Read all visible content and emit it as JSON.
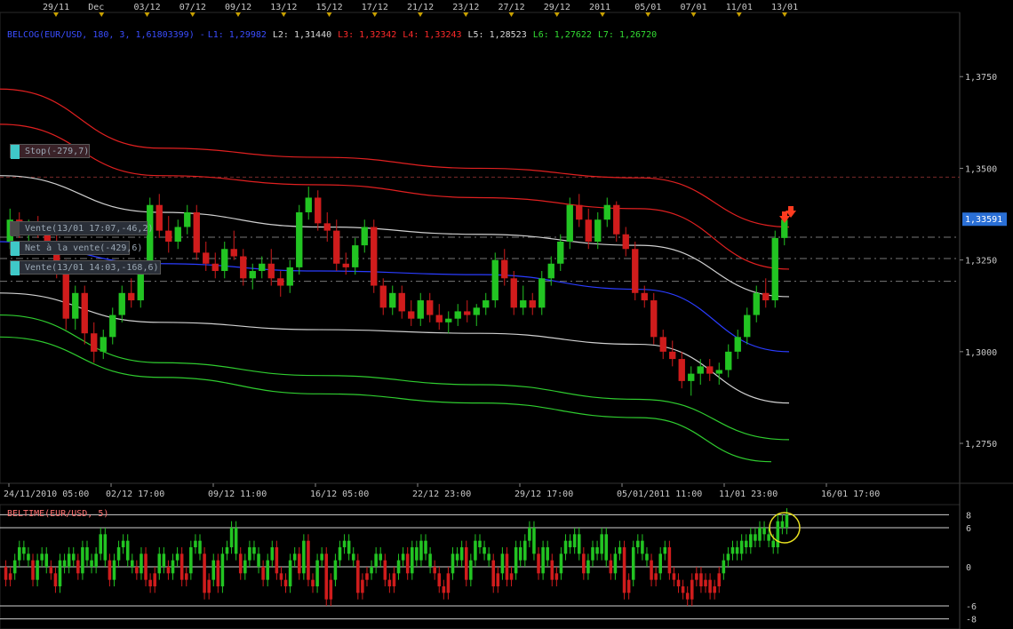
{
  "chart_data": [
    {
      "type": "candlestick",
      "legend": {
        "indicator": "BELCOG(EUR/USD, 180, 3, 1,61803399)",
        "levels": [
          {
            "label": "L1",
            "value": "1,29982",
            "color": "#3a4dff"
          },
          {
            "label": "L2",
            "value": "1,31440",
            "color": "#d8d8d8"
          },
          {
            "label": "L3",
            "value": "1,32342",
            "color": "#ff2a2a"
          },
          {
            "label": "L4",
            "value": "1,33243",
            "color": "#ff2a2a"
          },
          {
            "label": "L5",
            "value": "1,28523",
            "color": "#d8d8d8"
          },
          {
            "label": "L6",
            "value": "1,27622",
            "color": "#33dd33"
          },
          {
            "label": "L7",
            "value": "1,26720",
            "color": "#33dd33"
          }
        ]
      },
      "top_dates": [
        "29/11",
        "Dec",
        "03/12",
        "07/12",
        "09/12",
        "13/12",
        "15/12",
        "17/12",
        "21/12",
        "23/12",
        "27/12",
        "29/12",
        "2011",
        "05/01",
        "07/01",
        "11/01",
        "13/01"
      ],
      "x_labels": [
        "24/11/2010 05:00",
        "02/12 17:00",
        "09/12 11:00",
        "16/12 05:00",
        "22/12 23:00",
        "29/12 17:00",
        "05/01/2011 11:00",
        "11/01 23:00",
        "16/01 17:00"
      ],
      "y_ticks": [
        "1,3750",
        "1,3500",
        "1,3250",
        "1,3000",
        "1,2750"
      ],
      "ylim": [
        1.2675,
        1.3925
      ],
      "last_price": "1,33591",
      "horizontal_levels": [
        1.3476,
        1.3312,
        1.3254,
        1.3192
      ],
      "orders": [
        {
          "label": "Stop(-279,7)",
          "price": 1.3546,
          "color": "#3fc8c8",
          "box": "#3a2228"
        },
        {
          "label": "Vente(13/01 17:07,-46,2)",
          "price": 1.3337,
          "color": "#4a4a4a",
          "box": "#2a2f38"
        },
        {
          "label": "Net à la vente(-429,6)",
          "price": 1.3282,
          "color": "#3fc8c8",
          "box": "#2a2f38"
        },
        {
          "label": "Vente(13/01 14:03,-168,6)",
          "price": 1.323,
          "color": "#3fc8c8",
          "box": "#2a2f38"
        }
      ],
      "candles_ohlc": [
        [
          1.33,
          1.339,
          1.328,
          1.336
        ],
        [
          1.336,
          1.338,
          1.331,
          1.333
        ],
        [
          1.333,
          1.336,
          1.33,
          1.334
        ],
        [
          1.334,
          1.337,
          1.331,
          1.332
        ],
        [
          1.332,
          1.335,
          1.328,
          1.33
        ],
        [
          1.33,
          1.333,
          1.32,
          1.322
        ],
        [
          1.322,
          1.325,
          1.306,
          1.309
        ],
        [
          1.309,
          1.318,
          1.306,
          1.316
        ],
        [
          1.316,
          1.318,
          1.302,
          1.305
        ],
        [
          1.305,
          1.308,
          1.297,
          1.3
        ],
        [
          1.3,
          1.306,
          1.298,
          1.304
        ],
        [
          1.304,
          1.312,
          1.302,
          1.31
        ],
        [
          1.31,
          1.318,
          1.308,
          1.316
        ],
        [
          1.316,
          1.32,
          1.312,
          1.314
        ],
        [
          1.314,
          1.325,
          1.312,
          1.323
        ],
        [
          1.323,
          1.342,
          1.321,
          1.34
        ],
        [
          1.34,
          1.343,
          1.331,
          1.333
        ],
        [
          1.333,
          1.337,
          1.327,
          1.33
        ],
        [
          1.33,
          1.336,
          1.328,
          1.334
        ],
        [
          1.334,
          1.34,
          1.332,
          1.338
        ],
        [
          1.338,
          1.34,
          1.325,
          1.327
        ],
        [
          1.327,
          1.33,
          1.322,
          1.324
        ],
        [
          1.324,
          1.327,
          1.32,
          1.322
        ],
        [
          1.322,
          1.33,
          1.32,
          1.328
        ],
        [
          1.328,
          1.333,
          1.325,
          1.326
        ],
        [
          1.326,
          1.328,
          1.318,
          1.32
        ],
        [
          1.32,
          1.324,
          1.317,
          1.322
        ],
        [
          1.322,
          1.326,
          1.32,
          1.324
        ],
        [
          1.324,
          1.328,
          1.318,
          1.32
        ],
        [
          1.32,
          1.322,
          1.315,
          1.318
        ],
        [
          1.318,
          1.325,
          1.316,
          1.323
        ],
        [
          1.323,
          1.34,
          1.321,
          1.338
        ],
        [
          1.338,
          1.345,
          1.336,
          1.342
        ],
        [
          1.342,
          1.344,
          1.333,
          1.335
        ],
        [
          1.335,
          1.338,
          1.33,
          1.333
        ],
        [
          1.333,
          1.336,
          1.322,
          1.324
        ],
        [
          1.324,
          1.327,
          1.321,
          1.323
        ],
        [
          1.323,
          1.331,
          1.321,
          1.329
        ],
        [
          1.329,
          1.336,
          1.327,
          1.334
        ],
        [
          1.334,
          1.336,
          1.316,
          1.318
        ],
        [
          1.318,
          1.32,
          1.31,
          1.312
        ],
        [
          1.312,
          1.318,
          1.31,
          1.316
        ],
        [
          1.316,
          1.318,
          1.309,
          1.311
        ],
        [
          1.311,
          1.314,
          1.307,
          1.309
        ],
        [
          1.309,
          1.316,
          1.307,
          1.314
        ],
        [
          1.314,
          1.316,
          1.308,
          1.31
        ],
        [
          1.31,
          1.313,
          1.306,
          1.308
        ],
        [
          1.308,
          1.311,
          1.305,
          1.309
        ],
        [
          1.309,
          1.313,
          1.307,
          1.311
        ],
        [
          1.311,
          1.314,
          1.308,
          1.31
        ],
        [
          1.31,
          1.313,
          1.307,
          1.312
        ],
        [
          1.312,
          1.316,
          1.31,
          1.314
        ],
        [
          1.314,
          1.327,
          1.312,
          1.325
        ],
        [
          1.325,
          1.328,
          1.318,
          1.32
        ],
        [
          1.32,
          1.322,
          1.31,
          1.312
        ],
        [
          1.312,
          1.318,
          1.31,
          1.314
        ],
        [
          1.314,
          1.316,
          1.31,
          1.312
        ],
        [
          1.312,
          1.322,
          1.31,
          1.32
        ],
        [
          1.32,
          1.326,
          1.318,
          1.324
        ],
        [
          1.324,
          1.332,
          1.322,
          1.33
        ],
        [
          1.33,
          1.342,
          1.328,
          1.34
        ],
        [
          1.34,
          1.343,
          1.334,
          1.336
        ],
        [
          1.336,
          1.339,
          1.328,
          1.33
        ],
        [
          1.33,
          1.338,
          1.328,
          1.336
        ],
        [
          1.336,
          1.342,
          1.334,
          1.34
        ],
        [
          1.34,
          1.341,
          1.33,
          1.332
        ],
        [
          1.332,
          1.334,
          1.326,
          1.328
        ],
        [
          1.328,
          1.33,
          1.314,
          1.316
        ],
        [
          1.316,
          1.318,
          1.312,
          1.314
        ],
        [
          1.314,
          1.316,
          1.302,
          1.304
        ],
        [
          1.304,
          1.306,
          1.298,
          1.3
        ],
        [
          1.3,
          1.303,
          1.296,
          1.298
        ],
        [
          1.298,
          1.3,
          1.29,
          1.292
        ],
        [
          1.292,
          1.296,
          1.288,
          1.294
        ],
        [
          1.294,
          1.298,
          1.291,
          1.296
        ],
        [
          1.296,
          1.298,
          1.292,
          1.294
        ],
        [
          1.294,
          1.297,
          1.291,
          1.295
        ],
        [
          1.295,
          1.302,
          1.293,
          1.3
        ],
        [
          1.3,
          1.306,
          1.298,
          1.304
        ],
        [
          1.304,
          1.312,
          1.302,
          1.31
        ],
        [
          1.31,
          1.318,
          1.308,
          1.316
        ],
        [
          1.316,
          1.32,
          1.312,
          1.314
        ],
        [
          1.314,
          1.333,
          1.312,
          1.331
        ],
        [
          1.331,
          1.337,
          1.329,
          1.336
        ]
      ],
      "bands": [
        {
          "name": "L4",
          "color": "#e02020",
          "x": [
            0,
            180,
            360,
            540,
            720,
            888
          ],
          "y": [
            1.3716,
            1.3555,
            1.353,
            1.35,
            1.3474,
            1.334
          ]
        },
        {
          "name": "L3",
          "color": "#e02020",
          "x": [
            0,
            180,
            360,
            540,
            720,
            888
          ],
          "y": [
            1.362,
            1.348,
            1.3455,
            1.342,
            1.339,
            1.3225
          ]
        },
        {
          "name": "L2",
          "color": "#d0d0d0",
          "x": [
            0,
            180,
            360,
            540,
            720,
            888
          ],
          "y": [
            1.348,
            1.338,
            1.334,
            1.332,
            1.329,
            1.315
          ]
        },
        {
          "name": "L1",
          "color": "#2a3cff",
          "x": [
            0,
            180,
            360,
            540,
            720,
            888
          ],
          "y": [
            1.33,
            1.324,
            1.322,
            1.321,
            1.317,
            1.3
          ]
        },
        {
          "name": "L5",
          "color": "#d0d0d0",
          "x": [
            0,
            180,
            360,
            540,
            720,
            888
          ],
          "y": [
            1.316,
            1.308,
            1.306,
            1.305,
            1.302,
            1.286
          ]
        },
        {
          "name": "L6",
          "color": "#2fcc2f",
          "x": [
            0,
            180,
            360,
            540,
            720,
            888
          ],
          "y": [
            1.31,
            1.297,
            1.2935,
            1.291,
            1.287,
            1.276
          ]
        },
        {
          "name": "L7",
          "color": "#2fcc2f",
          "x": [
            0,
            180,
            360,
            540,
            720,
            868
          ],
          "y": [
            1.304,
            1.293,
            1.2885,
            1.286,
            1.282,
            1.27
          ]
        }
      ]
    },
    {
      "type": "bar",
      "title": "BELTIME(EUR/USD, 5)",
      "ylim": [
        -9,
        9
      ],
      "y_ticks": [
        "8",
        "6",
        "0",
        "-6",
        "-8"
      ],
      "levels": [
        8,
        6,
        0,
        -6,
        -8
      ],
      "values": [
        -2,
        -1,
        1,
        3,
        2,
        1,
        -2,
        1,
        2,
        0,
        -1,
        -3,
        1,
        0,
        2,
        1,
        -1,
        3,
        1,
        0,
        2,
        5,
        1,
        -2,
        1,
        3,
        4,
        1,
        0,
        -1,
        2,
        -2,
        -3,
        -1,
        2,
        0,
        -1,
        1,
        2,
        -2,
        -1,
        3,
        4,
        2,
        -4,
        -2,
        1,
        -3,
        2,
        3,
        6,
        2,
        -1,
        1,
        3,
        2,
        0,
        -2,
        1,
        3,
        -1,
        -2,
        -3,
        1,
        2,
        -1,
        4,
        -2,
        -3,
        1,
        2,
        -5,
        -2,
        1,
        3,
        4,
        2,
        1,
        -4,
        -2,
        -1,
        0,
        2,
        1,
        -2,
        -3,
        -1,
        1,
        2,
        -1,
        3,
        1,
        4,
        2,
        0,
        -1,
        -3,
        -4,
        -1,
        2,
        1,
        3,
        -2,
        1,
        4,
        3,
        2,
        1,
        -3,
        -1,
        2,
        -2,
        -1,
        3,
        1,
        4,
        6,
        2,
        -1,
        3,
        1,
        -2,
        -1,
        2,
        4,
        3,
        5,
        2,
        -1,
        1,
        3,
        2,
        5,
        1,
        -1,
        2,
        3,
        -4,
        -2,
        3,
        4,
        2,
        1,
        -2,
        -1,
        2,
        3,
        -1,
        -2,
        -3,
        -4,
        -5,
        -2,
        -1,
        -3,
        -2,
        -4,
        -3,
        -1,
        1,
        2,
        3,
        2,
        4,
        3,
        5,
        4,
        6,
        5,
        4,
        3,
        7,
        6,
        8
      ]
    }
  ]
}
